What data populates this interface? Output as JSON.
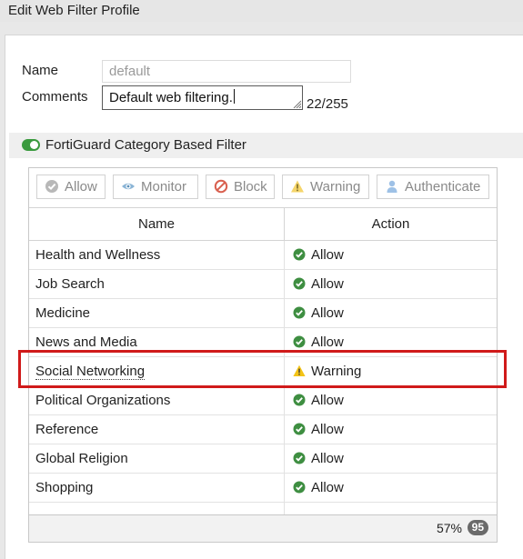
{
  "window": {
    "title": "Edit Web Filter Profile"
  },
  "form": {
    "name_label": "Name",
    "name_placeholder": "default",
    "comments_label": "Comments",
    "comments_value": "Default web filtering.",
    "comments_counter": "22/255"
  },
  "section": {
    "title": "FortiGuard Category Based Filter",
    "enabled": true
  },
  "toolbar": {
    "buttons": [
      {
        "label": "Allow",
        "icon": "check-circle-icon"
      },
      {
        "label": "Monitor",
        "icon": "eye-icon"
      },
      {
        "label": "Block",
        "icon": "block-icon"
      },
      {
        "label": "Warning",
        "icon": "warning-triangle-icon"
      },
      {
        "label": "Authenticate",
        "icon": "user-icon"
      }
    ]
  },
  "table": {
    "columns": [
      "Name",
      "Action"
    ],
    "rows": [
      {
        "name": "Health and Wellness",
        "action": "Allow",
        "action_icon": "check-circle-icon"
      },
      {
        "name": "Job Search",
        "action": "Allow",
        "action_icon": "check-circle-icon"
      },
      {
        "name": "Medicine",
        "action": "Allow",
        "action_icon": "check-circle-icon"
      },
      {
        "name": "News and Media",
        "action": "Allow",
        "action_icon": "check-circle-icon"
      },
      {
        "name": "Social Networking",
        "action": "Warning",
        "action_icon": "warning-triangle-icon",
        "highlighted": true
      },
      {
        "name": "Political Organizations",
        "action": "Allow",
        "action_icon": "check-circle-icon"
      },
      {
        "name": "Reference",
        "action": "Allow",
        "action_icon": "check-circle-icon"
      },
      {
        "name": "Global Religion",
        "action": "Allow",
        "action_icon": "check-circle-icon"
      },
      {
        "name": "Shopping",
        "action": "Allow",
        "action_icon": "check-circle-icon"
      }
    ]
  },
  "footer": {
    "percent": "57%",
    "count": "95"
  },
  "colors": {
    "allow_green": "#3e8e41",
    "warning_yellow": "#f3c316",
    "highlight_red": "#d01a1a",
    "toggle_green": "#3a9a3e"
  }
}
